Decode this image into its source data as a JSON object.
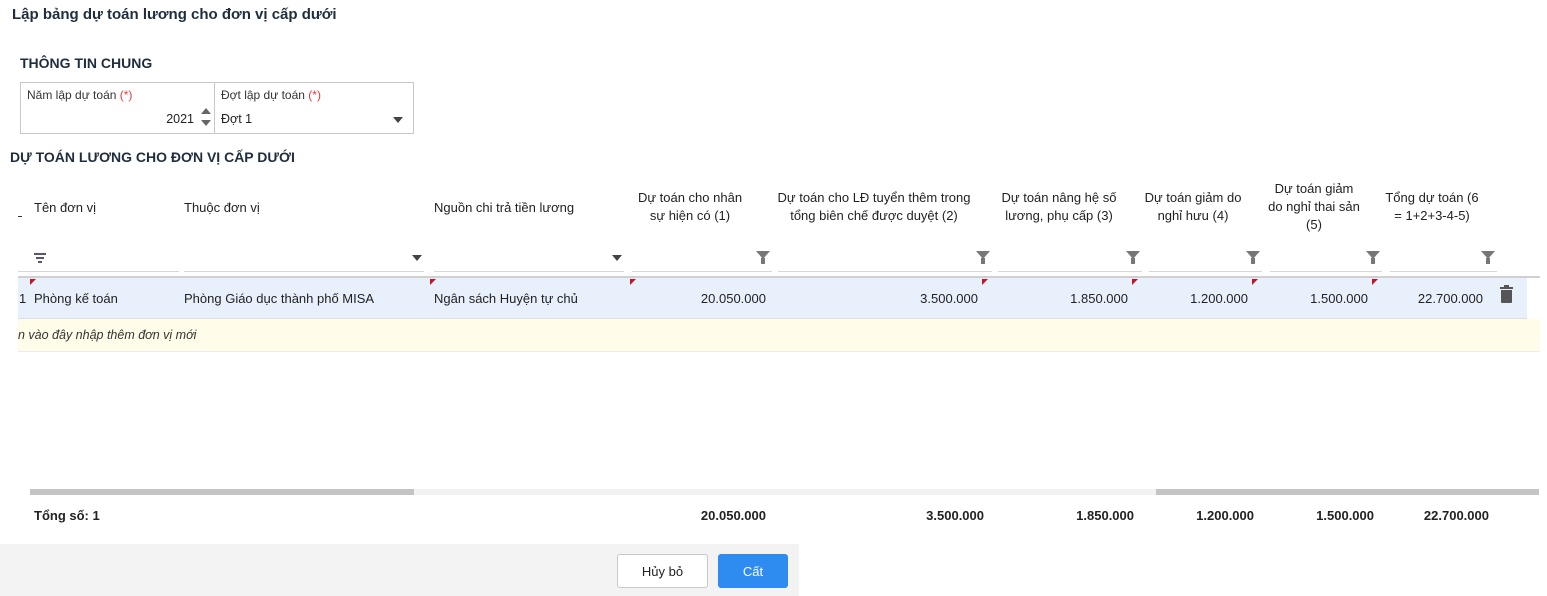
{
  "page": {
    "title": "Lập bảng dự toán lương cho đơn vị cấp dưới"
  },
  "general": {
    "title": "THÔNG TIN CHUNG",
    "year_label": "Năm lập dự toán",
    "year_value": "2021",
    "round_label": "Đợt lập dự toán",
    "round_value": "Đợt 1",
    "required_mark": "(*)"
  },
  "grid": {
    "title": "DỰ TOÁN LƯƠNG CHO ĐƠN VỊ CẤP DƯỚI",
    "columns": [
      "Tên đơn vị",
      "Thuộc đơn vị",
      "Nguồn chi trả tiền lương",
      "Dự toán cho nhân sự hiện có (1)",
      "Dự toán cho LĐ tuyển thêm trong tổng biên chế được duyệt (2)",
      "Dự toán nâng hệ số lương, phụ cấp (3)",
      "Dự toán giảm do nghỉ hưu (4)",
      "Dự toán giảm do nghỉ thai sản (5)",
      "Tổng dự toán (6 = 1+2+3-4-5)"
    ],
    "rows": [
      {
        "index": "1",
        "unit": "Phòng kế toán",
        "parent": "Phòng Giáo dục thành phố MISA",
        "source": "Ngân sách Huyện tự chủ",
        "c1": "20.050.000",
        "c2": "3.500.000",
        "c3": "1.850.000",
        "c4": "1.200.000",
        "c5": "1.500.000",
        "c6": "22.700.000"
      }
    ],
    "add_row_hint": "n vào đây nhập thêm đơn vị mới",
    "footer": {
      "label": "Tổng số: 1",
      "c1": "20.050.000",
      "c2": "3.500.000",
      "c3": "1.850.000",
      "c4": "1.200.000",
      "c5": "1.500.000",
      "c6": "22.700.000"
    }
  },
  "actions": {
    "cancel": "Hủy bỏ",
    "save": "Cất"
  },
  "colors": {
    "primary": "#2e8cf0",
    "row_selected": "#e8f0fb",
    "add_row_bg": "#fffde9",
    "required": "#e8393a"
  }
}
